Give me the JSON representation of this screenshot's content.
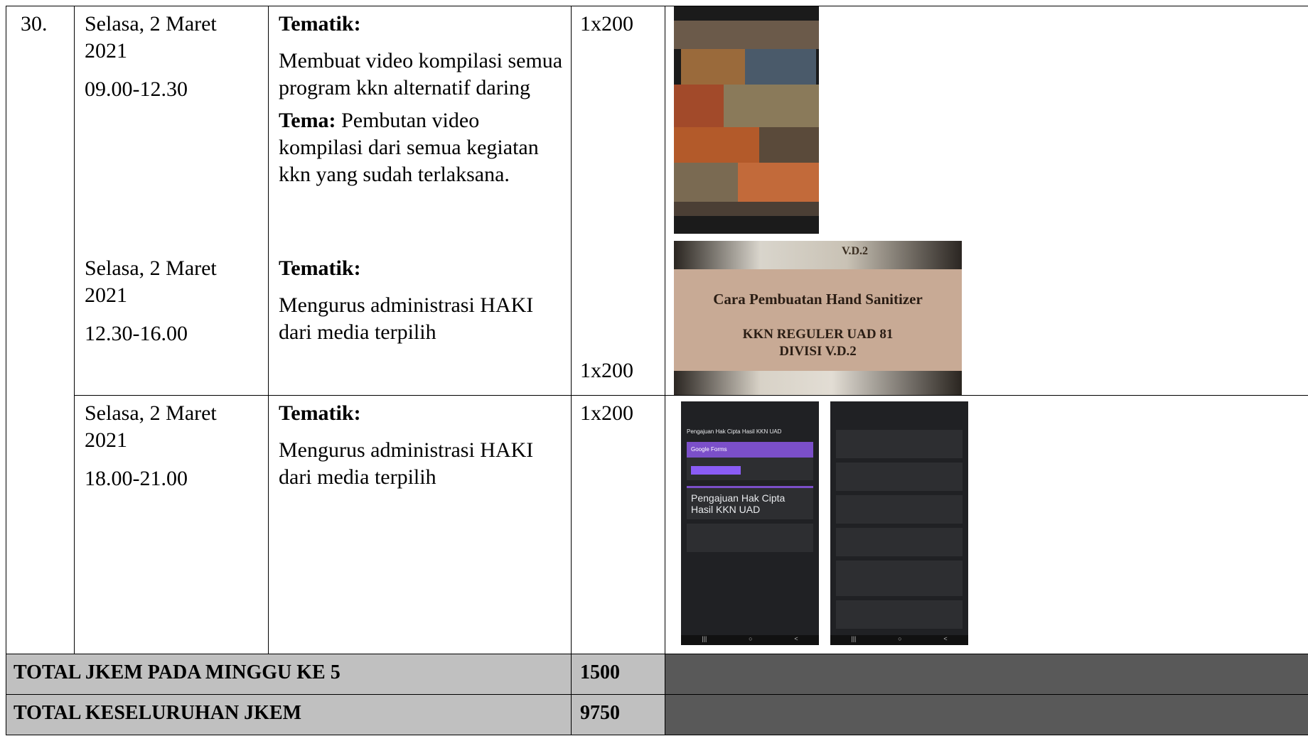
{
  "row": {
    "number": "30.",
    "entries": [
      {
        "day": "Selasa, 2 Maret",
        "year": "2021",
        "time": "09.00-12.30",
        "label1": "Tematik:",
        "text1": "Membuat video kompilasi semua program kkn alternatif daring",
        "label2": "Tema:",
        "text2": " Pembutan video kompilasi dari semua kegiatan kkn yang sudah terlaksana.",
        "jkem": "1x200"
      },
      {
        "day": "Selasa, 2 Maret",
        "year": "2021",
        "time": "12.30-16.00",
        "label1": "Tematik:",
        "text1": "Mengurus administrasi HAKI dari media terpilih",
        "jkem": "1x200"
      },
      {
        "day": "Selasa, 2 Maret",
        "year": "2021",
        "time": "18.00-21.00",
        "label1": "Tematik:",
        "text1": "Mengurus administrasi HAKI dari media terpilih",
        "jkem": "1x200"
      }
    ]
  },
  "images": {
    "sanitizer": {
      "logo": "V.D.2",
      "title": "Cara Pembuatan Hand Sanitizer",
      "line1": "KKN REGULER UAD 81",
      "line2": "DIVISI V.D.2"
    },
    "phone1": {
      "form_title": "Pengajuan Hak Cipta Hasil KKN UAD",
      "brand": "Google Forms",
      "big_title": "Pengajuan Hak Cipta Hasil KKN UAD"
    }
  },
  "totals": [
    {
      "label": "TOTAL JKEM PADA MINGGU KE 5",
      "value": "1500"
    },
    {
      "label": "TOTAL KESELURUHAN JKEM",
      "value": "9750"
    }
  ],
  "colors": {
    "footer_label_bg": "#c0c0c0",
    "footer_dark_bg": "#595959"
  }
}
